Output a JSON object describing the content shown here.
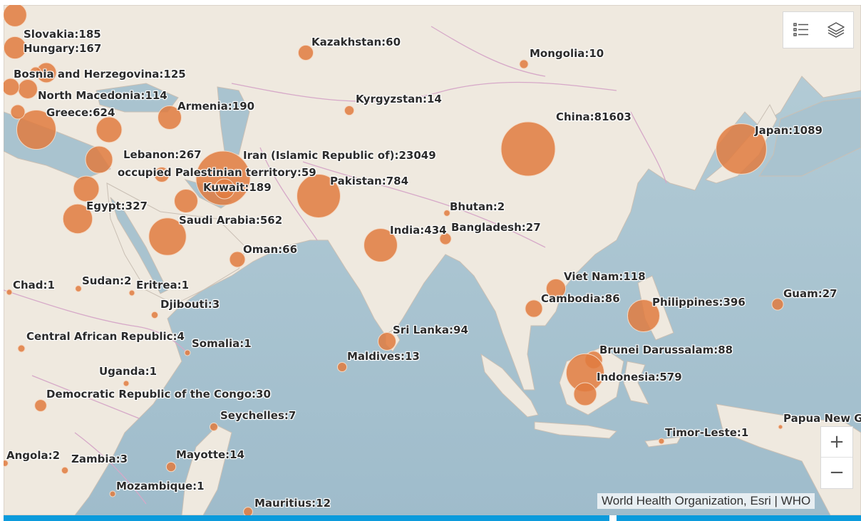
{
  "colors": {
    "water": "#a9c3cf",
    "land": "#efe9df",
    "bubble": "#e07b3f",
    "bubble_stroke": "#f4d9c4",
    "accent_bar": "#0b9bdc"
  },
  "toolbar": {
    "legend_icon": "legend-list-icon",
    "layers_icon": "layers-icon"
  },
  "zoom": {
    "in_label": "+",
    "out_label": "−"
  },
  "attribution": "World Health Organization, Esri | WHO",
  "countries": [
    {
      "name": "Slovakia",
      "cases": 185
    },
    {
      "name": "Hungary",
      "cases": 167
    },
    {
      "name": "Bosnia and Herzegovina",
      "cases": 125
    },
    {
      "name": "North Macedonia",
      "cases": 114
    },
    {
      "name": "Greece",
      "cases": 624
    },
    {
      "name": "Armenia",
      "cases": 190
    },
    {
      "name": "Kazakhstan",
      "cases": 60
    },
    {
      "name": "Mongolia",
      "cases": 10
    },
    {
      "name": "Kyrgyzstan",
      "cases": 14
    },
    {
      "name": "China",
      "cases": 81603
    },
    {
      "name": "Japan",
      "cases": 1089
    },
    {
      "name": "Lebanon",
      "cases": 267
    },
    {
      "name": "Iran (Islamic Republic of)",
      "cases": 23049
    },
    {
      "name": "occupied Palestinian territory",
      "cases": 59
    },
    {
      "name": "Kuwait",
      "cases": 189
    },
    {
      "name": "Pakistan",
      "cases": 784
    },
    {
      "name": "Egypt",
      "cases": 327
    },
    {
      "name": "Bhutan",
      "cases": 2
    },
    {
      "name": "Saudi Arabia",
      "cases": 562
    },
    {
      "name": "Bangladesh",
      "cases": 27
    },
    {
      "name": "India",
      "cases": 434
    },
    {
      "name": "Oman",
      "cases": 66
    },
    {
      "name": "Viet Nam",
      "cases": 118
    },
    {
      "name": "Chad",
      "cases": 1
    },
    {
      "name": "Sudan",
      "cases": 2
    },
    {
      "name": "Eritrea",
      "cases": 1
    },
    {
      "name": "Cambodia",
      "cases": 86
    },
    {
      "name": "Philippines",
      "cases": 396
    },
    {
      "name": "Guam",
      "cases": 27
    },
    {
      "name": "Djibouti",
      "cases": 3
    },
    {
      "name": "Sri Lanka",
      "cases": 94
    },
    {
      "name": "Central African Republic",
      "cases": 4
    },
    {
      "name": "Somalia",
      "cases": 1
    },
    {
      "name": "Brunei Darussalam",
      "cases": 88
    },
    {
      "name": "Maldives",
      "cases": 13
    },
    {
      "name": "Uganda",
      "cases": 1
    },
    {
      "name": "Indonesia",
      "cases": 579
    },
    {
      "name": "Democratic Republic of the Congo",
      "cases": 30
    },
    {
      "name": "Seychelles",
      "cases": 7
    },
    {
      "name": "Papua New G",
      "cases": null
    },
    {
      "name": "Timor-Leste",
      "cases": 1
    },
    {
      "name": "Angola",
      "cases": 2
    },
    {
      "name": "Zambia",
      "cases": 3
    },
    {
      "name": "Mayotte",
      "cases": 14
    },
    {
      "name": "Mozambique",
      "cases": 1
    },
    {
      "name": "Mauritius",
      "cases": 12
    }
  ]
}
